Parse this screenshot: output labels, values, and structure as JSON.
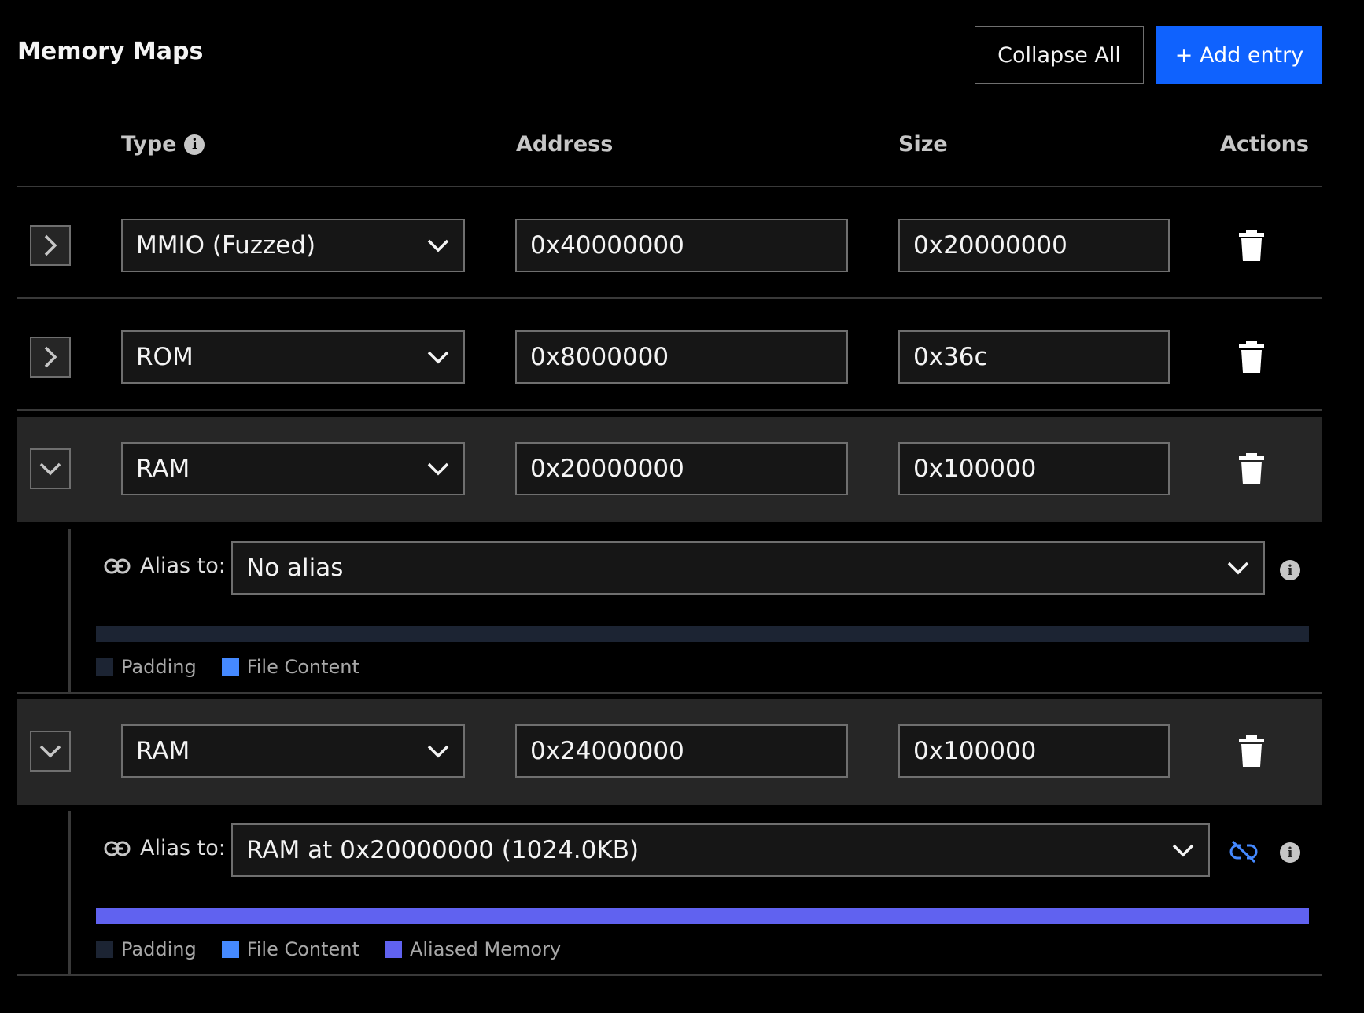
{
  "header": {
    "title": "Memory Maps",
    "collapse_label": "Collapse All",
    "add_label": "+ Add entry"
  },
  "columns": {
    "type": "Type",
    "address": "Address",
    "size": "Size",
    "actions": "Actions"
  },
  "rows": [
    {
      "type": "MMIO (Fuzzed)",
      "address": "0x40000000",
      "size": "0x20000000",
      "expanded": false
    },
    {
      "type": "ROM",
      "address": "0x8000000",
      "size": "0x36c",
      "expanded": false
    },
    {
      "type": "RAM",
      "address": "0x20000000",
      "size": "0x100000",
      "expanded": true
    },
    {
      "type": "RAM",
      "address": "0x24000000",
      "size": "0x100000",
      "expanded": true
    }
  ],
  "details": [
    {
      "alias_label": "Alias to:",
      "alias_value": "No alias",
      "legend": [
        "Padding",
        "File Content"
      ]
    },
    {
      "alias_label": "Alias to:",
      "alias_value": "RAM at 0x20000000 (1024.0KB)",
      "legend": [
        "Padding",
        "File Content",
        "Aliased Memory"
      ]
    }
  ],
  "colors": {
    "accent": "#0f62fe",
    "padding": "#1c2433",
    "file_content": "#4589ff",
    "aliased_memory": "#6062f0",
    "unlink_icon": "#4589ff"
  }
}
